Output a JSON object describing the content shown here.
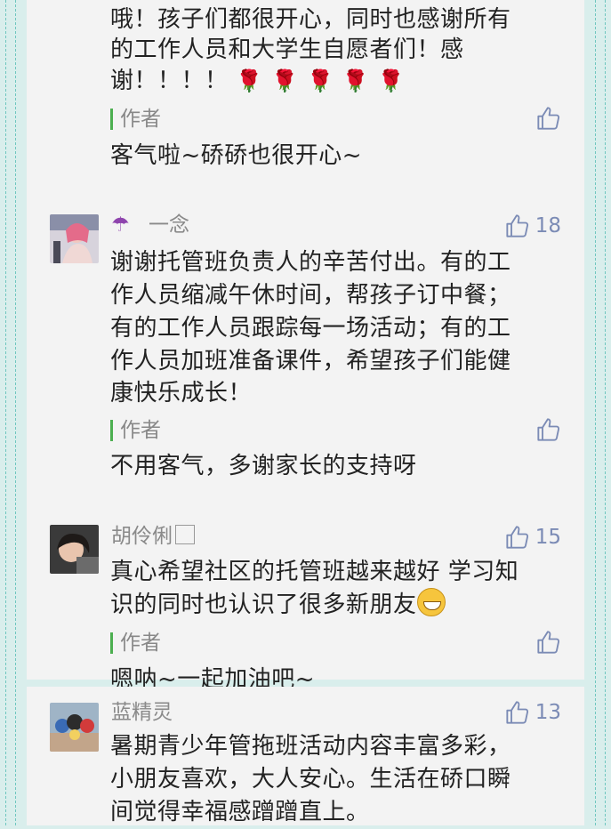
{
  "comment0": {
    "lines": [
      "哦！孩子们都很开心，同时也感谢所有",
      "的工作人员和大学生自愿者们！感",
      "谢！！！！"
    ],
    "roses": "🌹🌹🌹🌹🌹",
    "reply_label": "作者",
    "reply_text": "客气啦~硚硚也很开心~"
  },
  "comment1": {
    "name": "一念",
    "likes": "18",
    "lines": [
      "谢谢托管班负责人的辛苦付出。有的工",
      "作人员缩减午休时间，帮孩子订中餐；",
      "有的工作人员跟踪每一场活动；有的工",
      "作人员加班准备课件，希望孩子们能健",
      "康快乐成长！"
    ],
    "reply_label": "作者",
    "reply_text": "不用客气，多谢家长的支持呀"
  },
  "comment2": {
    "name": "胡伶俐",
    "likes": "15",
    "lines": [
      "真心希望社区的托管班越来越好 学习知",
      "识的同时也认识了很多新朋友"
    ],
    "reply_label": "作者",
    "reply_text": "嗯呐~一起加油吧~"
  },
  "comment3": {
    "name": "蓝精灵",
    "likes": "13",
    "lines": [
      "暑期青少年管拖班活动内容丰富多彩，",
      "小朋友喜欢，大人安心。生活在硚口瞬",
      "间觉得幸福感蹭蹭直上。"
    ]
  },
  "colors": {
    "accent": "#4caf50",
    "like": "#7b8bb5",
    "background": "#d9eeec"
  }
}
